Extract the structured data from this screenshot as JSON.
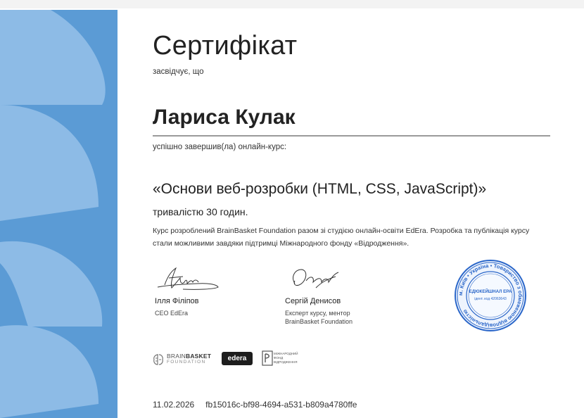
{
  "certificate": {
    "title": "Сертифікат",
    "subtitle": "засвідчує, що",
    "recipient": "Лариса Кулак",
    "completed_text": "успішно завершив(ла) онлайн-курс:",
    "course_name": "«Основи веб-розробки (HTML, CSS, JavaScript)»",
    "duration": "тривалістю 30 годин.",
    "description": "Курс розроблений BrainBasket Foundation разом зі студією онлайн-освіти EdEra. Розробка та публікація курсу стали можливими завдяки підтримці Міжнародного фонду «Відродження»."
  },
  "signatures": [
    {
      "name": "Ілля Філіпов",
      "role": [
        "CEO EdEra"
      ]
    },
    {
      "name": "Сергій Денисов",
      "role": [
        "Експерт курсу, ментор",
        "BrainBasket Foundation"
      ]
    }
  ],
  "seal": {
    "outer_text": "м. Київ • Україна • Товариство з обмеженою відповідальністю",
    "center_text": "ЕДЮКЕЙШНАЛ ЕРА",
    "code": "ідент. код 42063643"
  },
  "logos": {
    "brainbasket_line1_light": "BRAIN",
    "brainbasket_line1_bold": "BASKET",
    "brainbasket_line2": "FOUNDATION",
    "edera": "edera",
    "fund_lines": [
      "МІЖНАРОДНИЙ",
      "ФОНД",
      "ВІДРОДЖЕННЯ"
    ]
  },
  "footer": {
    "date": "11.02.2026",
    "certificate_id": "fb15016c-bf98-4694-a531-b809a4780ffe"
  },
  "colors": {
    "band_blue": "#5b9bd5",
    "band_light": "#8dbbe6",
    "seal_blue": "#2a66c9"
  }
}
